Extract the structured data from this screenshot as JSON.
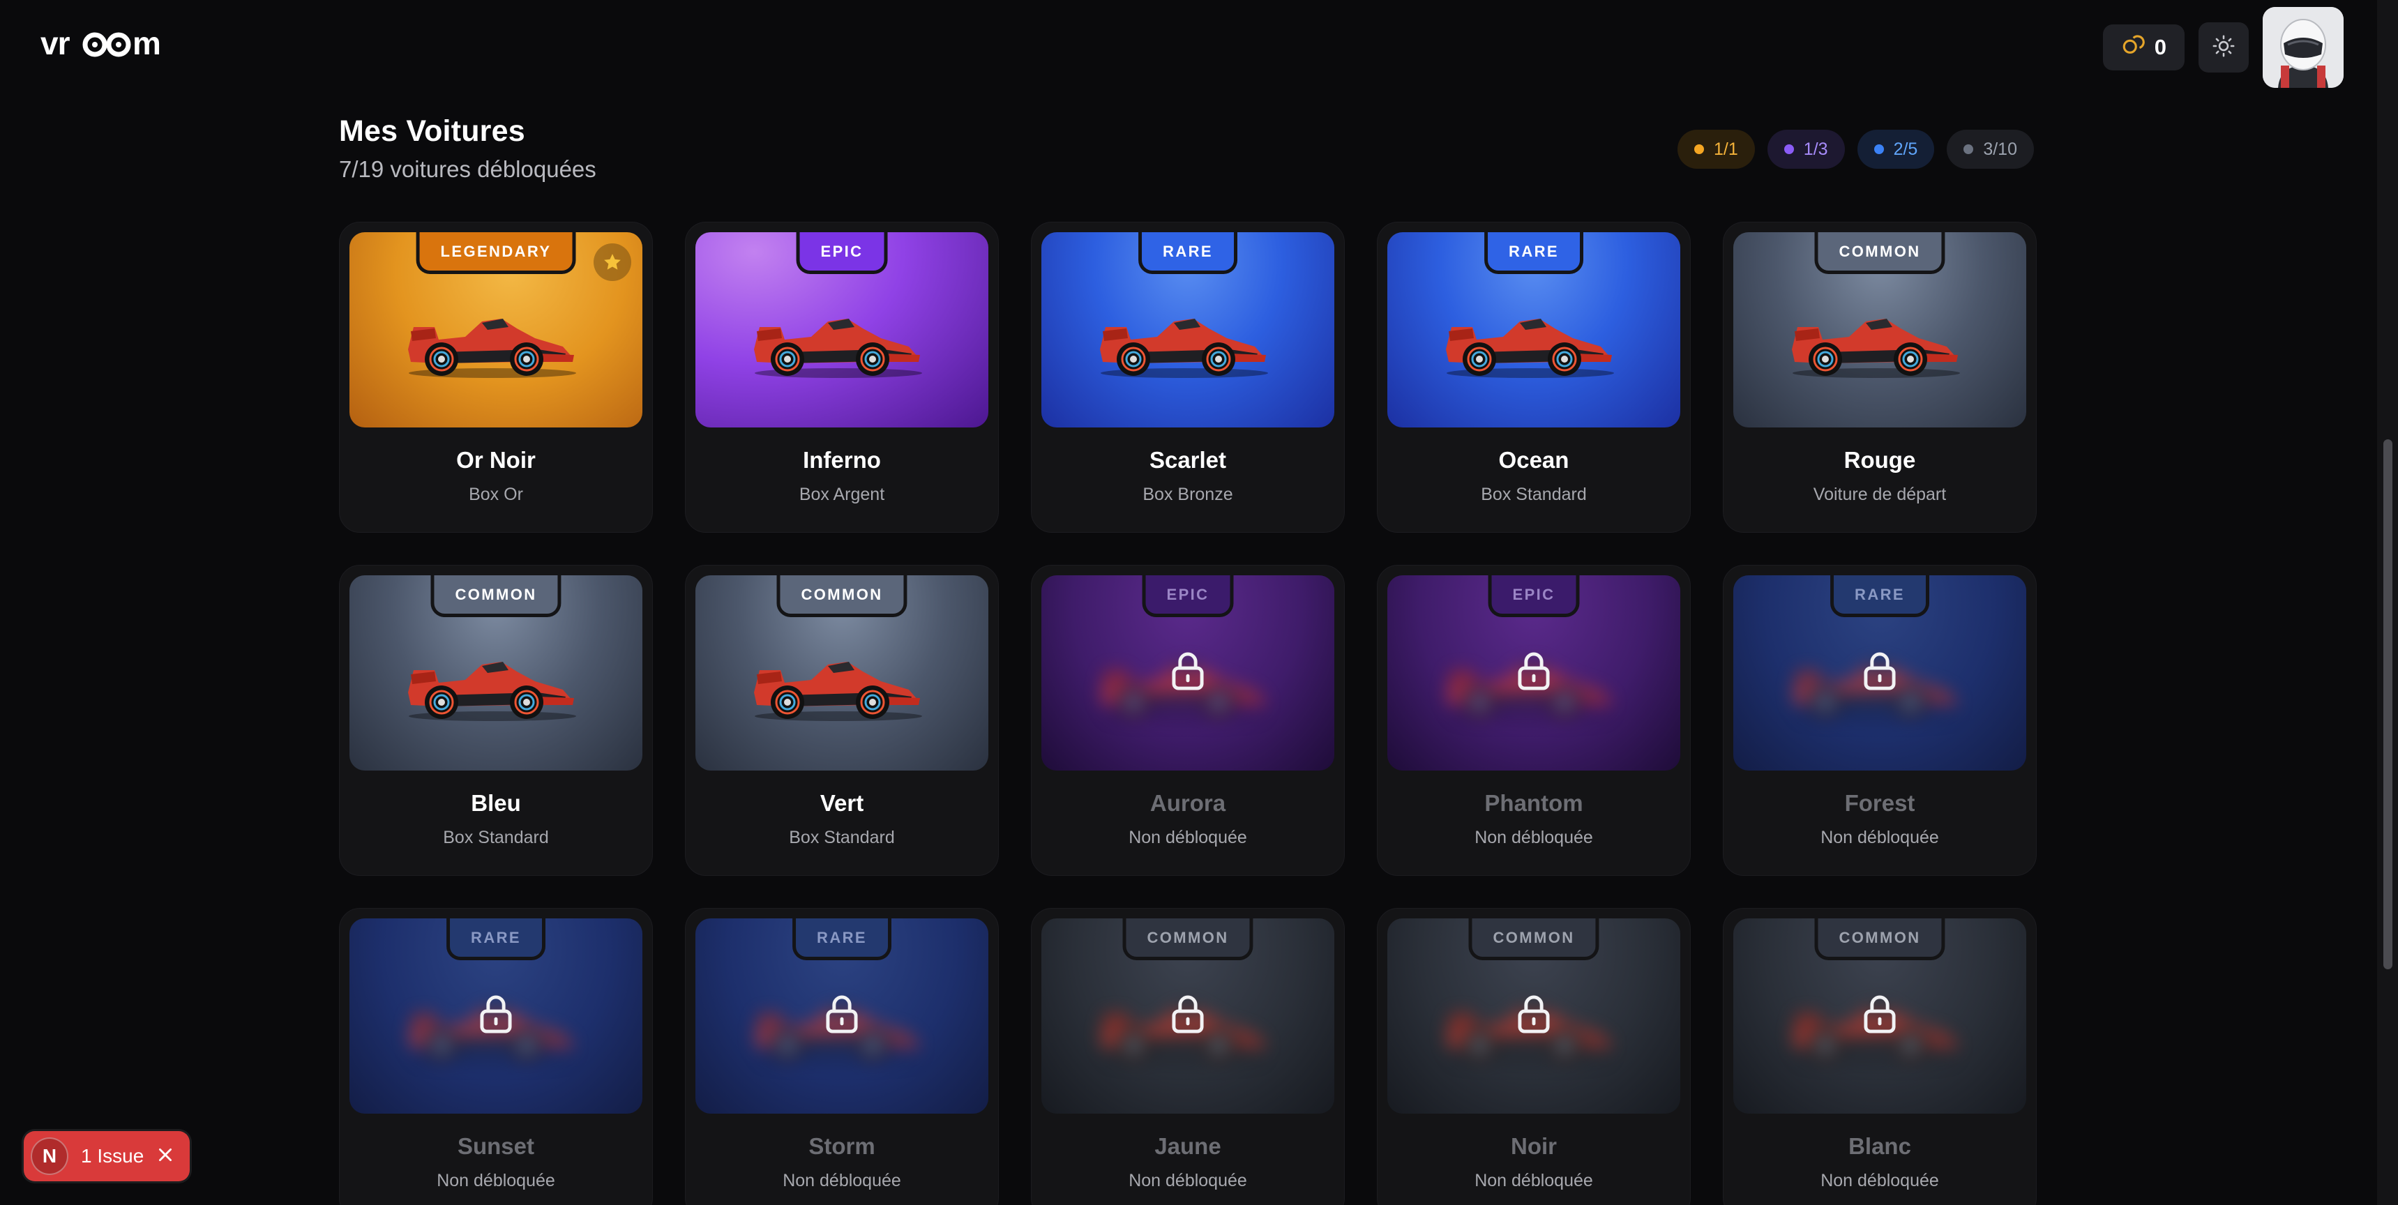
{
  "header": {
    "logo_text": "vroom",
    "coins": "0",
    "coin_icon": "coins-icon",
    "theme_icon": "sun-icon",
    "avatar_icon": "racer-helmet-avatar"
  },
  "page": {
    "title": "Mes Voitures",
    "subtitle": "7/19 voitures débloquées"
  },
  "rarity_counts": [
    {
      "label": "1/1",
      "color": "#f5a623",
      "bg": "#2a1f0c",
      "text": "#f5b33a"
    },
    {
      "label": "1/3",
      "color": "#8b5cf6",
      "bg": "#1d1830",
      "text": "#a78bfa"
    },
    {
      "label": "2/5",
      "color": "#3b82f6",
      "bg": "#141f35",
      "text": "#60a5fa"
    },
    {
      "label": "3/10",
      "color": "#6b7280",
      "bg": "#1c1d22",
      "text": "#9ca3af"
    }
  ],
  "cars": [
    {
      "name": "Or Noir",
      "source": "Box Or",
      "rarity": "LEGENDARY",
      "rarity_key": "legendary",
      "locked": false,
      "favorite": true
    },
    {
      "name": "Inferno",
      "source": "Box Argent",
      "rarity": "EPIC",
      "rarity_key": "epic",
      "locked": false,
      "favorite": false
    },
    {
      "name": "Scarlet",
      "source": "Box Bronze",
      "rarity": "RARE",
      "rarity_key": "rare",
      "locked": false,
      "favorite": false
    },
    {
      "name": "Ocean",
      "source": "Box Standard",
      "rarity": "RARE",
      "rarity_key": "rare",
      "locked": false,
      "favorite": false
    },
    {
      "name": "Rouge",
      "source": "Voiture de départ",
      "rarity": "COMMON",
      "rarity_key": "common",
      "locked": false,
      "favorite": false
    },
    {
      "name": "Bleu",
      "source": "Box Standard",
      "rarity": "COMMON",
      "rarity_key": "common",
      "locked": false,
      "favorite": false
    },
    {
      "name": "Vert",
      "source": "Box Standard",
      "rarity": "COMMON",
      "rarity_key": "common",
      "locked": false,
      "favorite": false
    },
    {
      "name": "Aurora",
      "source": "Non débloquée",
      "rarity": "EPIC",
      "rarity_key": "epic",
      "locked": true,
      "favorite": false
    },
    {
      "name": "Phantom",
      "source": "Non débloquée",
      "rarity": "EPIC",
      "rarity_key": "epic",
      "locked": true,
      "favorite": false
    },
    {
      "name": "Forest",
      "source": "Non débloquée",
      "rarity": "RARE",
      "rarity_key": "rare",
      "locked": true,
      "favorite": false
    },
    {
      "name": "Sunset",
      "source": "Non débloquée",
      "rarity": "RARE",
      "rarity_key": "rare",
      "locked": true,
      "favorite": false
    },
    {
      "name": "Storm",
      "source": "Non débloquée",
      "rarity": "RARE",
      "rarity_key": "rare",
      "locked": true,
      "favorite": false
    },
    {
      "name": "Jaune",
      "source": "Non débloquée",
      "rarity": "COMMON",
      "rarity_key": "common",
      "locked": true,
      "favorite": false
    },
    {
      "name": "Noir",
      "source": "Non débloquée",
      "rarity": "COMMON",
      "rarity_key": "common",
      "locked": true,
      "favorite": false
    },
    {
      "name": "Blanc",
      "source": "Non débloquée",
      "rarity": "COMMON",
      "rarity_key": "common",
      "locked": true,
      "favorite": false
    }
  ],
  "issue_badge": {
    "letter": "N",
    "label": "1 Issue",
    "close_icon": "close-icon"
  }
}
